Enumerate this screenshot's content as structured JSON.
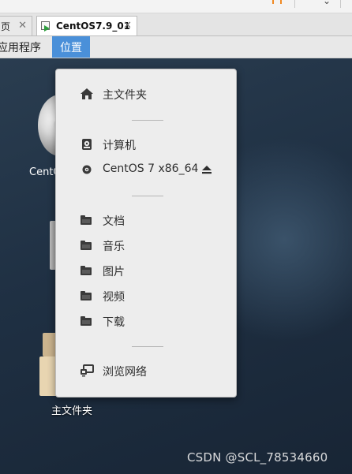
{
  "tabs": [
    {
      "label": "页",
      "close": "✕"
    },
    {
      "label": "CentOS7.9_01",
      "close": "✕"
    }
  ],
  "panel": {
    "applications": "应用程序",
    "places": "位置"
  },
  "desktop": {
    "cd_label": "CentO",
    "home_label": "主文件夹",
    "watermark": "CSDN @SCL_78534660"
  },
  "places_menu": {
    "home": "主文件夹",
    "computer": "计算机",
    "cdrom": "CentOS 7 x86_64",
    "documents": "文档",
    "music": "音乐",
    "pictures": "图片",
    "videos": "视频",
    "downloads": "下载",
    "browse_network": "浏览网络"
  },
  "icons": {
    "home": "home-icon",
    "computer": "drive-icon",
    "cdrom": "disc-icon",
    "eject": "eject-icon",
    "folder": "folder-icon",
    "network": "network-icon"
  },
  "colors": {
    "places_highlight": "#4a90d9",
    "menu_bg": "#ededed",
    "icon": "#3a3a3a"
  }
}
